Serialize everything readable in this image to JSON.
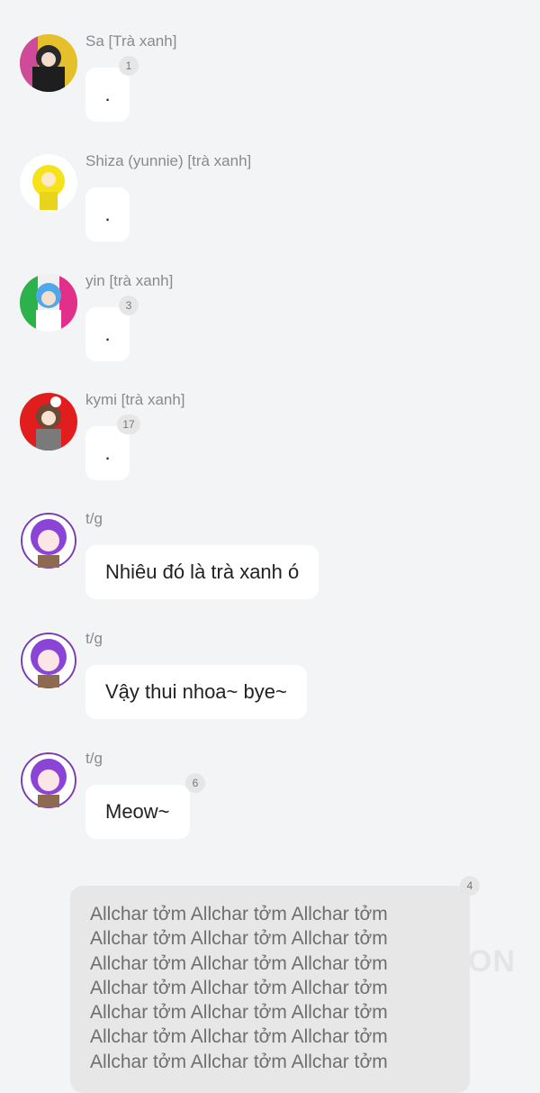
{
  "messages": [
    {
      "name": "Sa [Trà xanh]",
      "text": ".",
      "badge": "1"
    },
    {
      "name": "Shiza (yunnie) [trà xanh]",
      "text": "."
    },
    {
      "name": "yin [trà xanh]",
      "text": ".",
      "badge": "3"
    },
    {
      "name": "kymi [trà xanh]",
      "text": ".",
      "badge": "17"
    },
    {
      "name": "t/g",
      "text": "Nhiêu đó là trà xanh ó"
    },
    {
      "name": "t/g",
      "text": "Vậy thui nhoa~ bye~"
    },
    {
      "name": "t/g",
      "text": "Meow~",
      "badge": "6"
    }
  ],
  "notice": {
    "badge": "4",
    "lines": [
      "Allchar tởm Allchar tởm Allchar tởm",
      "Allchar tởm Allchar tởm Allchar tởm",
      "Allchar tởm Allchar tởm Allchar tởm",
      "Allchar tởm Allchar tởm Allchar tởm",
      "Allchar tởm Allchar tởm Allchar tởm",
      "Allchar tởm Allchar tởm Allchar tởm",
      "Allchar tởm Allchar tởm Allchar tởm"
    ]
  },
  "watermark": "ON"
}
